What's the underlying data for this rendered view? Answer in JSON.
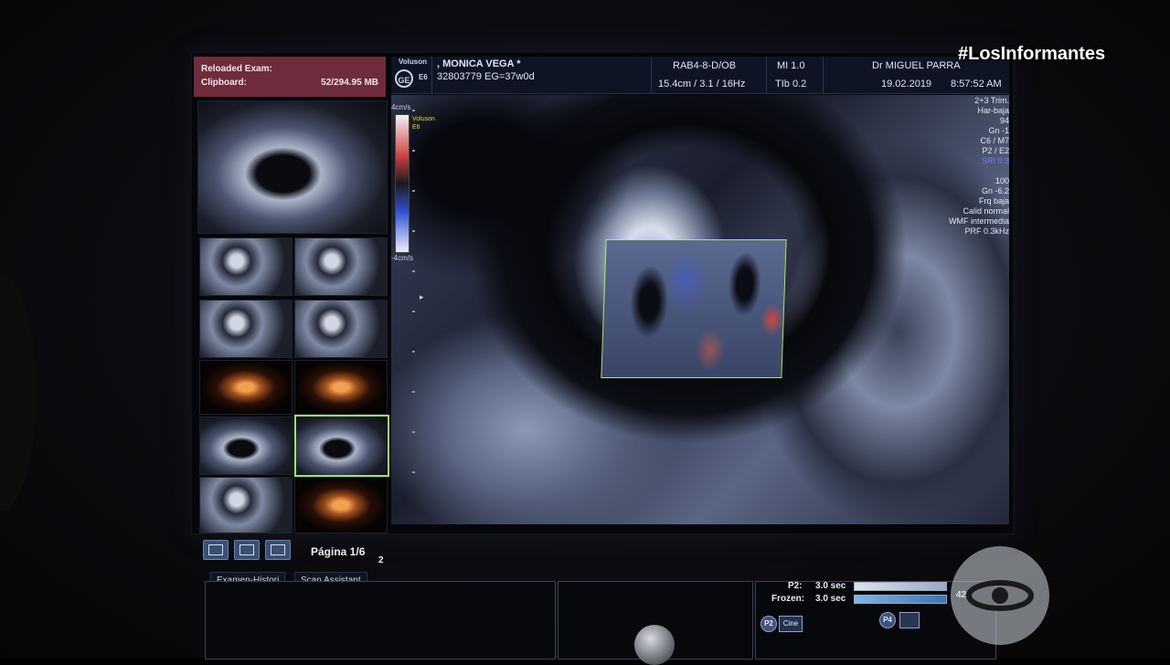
{
  "clipboard": {
    "title": "Reloaded Exam:",
    "label": "Clipboard:",
    "size": "52/294.95 MB",
    "page": "Página 1/6",
    "page_badge": "2",
    "view_buttons": [
      "single-view",
      "quad-view",
      "grid-view"
    ],
    "thumbnail_count": 13,
    "selected_thumbnail": 10
  },
  "header": {
    "logo_text": "Voluson",
    "logo_model": "E6",
    "patient_name": ", MONICA VEGA *",
    "patient_id_ga": "32803779  EG=37w0d",
    "probe": "RAB4-8-D/OB",
    "probe_params": "15.4cm / 3.1 / 16Hz",
    "mi": "MI  1.0",
    "tib": "TIb  0.2",
    "doctor": "Dr MIGUEL PARRA",
    "date": "19.02.2019",
    "time": "8:57:52 AM"
  },
  "image_view": {
    "scale_top": "4cm/s",
    "scale_bottom": "-4cm/s",
    "mini_tag_1": "Voluson",
    "mini_tag_2": "E6",
    "params": [
      "2+3 Trim.",
      "Har-baja",
      "94",
      "Gn  -1",
      "C6 / M7",
      "P2 / E2",
      "SRI II 3",
      "",
      "100",
      "Gn  -6.2",
      "Frq baja",
      "Calid normal",
      "WMF intermedia",
      "PRF  0.3kHz"
    ]
  },
  "bottom": {
    "tabs": [
      "Examen-Histori",
      "Scan Assistant"
    ],
    "p2_label": "P2:",
    "p2_value": "3.0 sec",
    "frozen_label": "Frozen:",
    "frozen_value": "3.0 sec",
    "frozen_count": "42",
    "p2_button": "P2",
    "p4_button": "P4",
    "cine_label": "Cine"
  },
  "overlay": {
    "hashtag": "#LosInformantes"
  },
  "colors": {
    "clipboard_header": "#6e2c3c",
    "roi_border": "#b9e46b",
    "selected_thumb": "#9ce27a",
    "header_bg": "#0f1424"
  }
}
